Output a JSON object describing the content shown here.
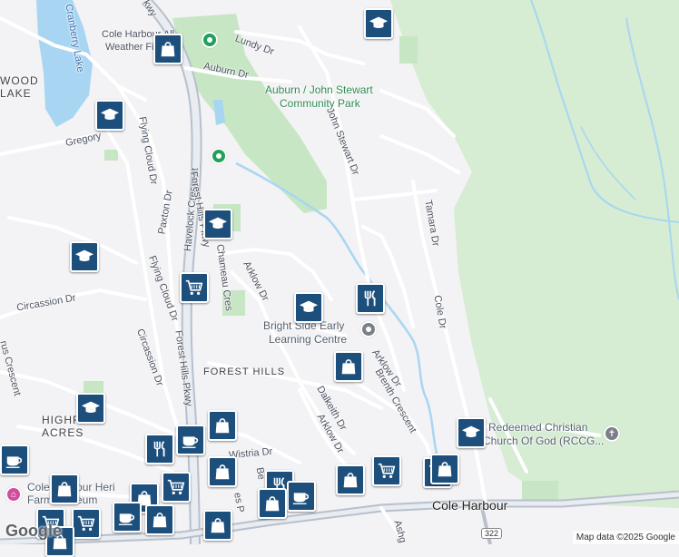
{
  "map": {
    "attribution": "Map data ©2025 Google",
    "logo": "Google",
    "route_shield": "322",
    "colors": {
      "marker": "#1d4f7c",
      "park": "#c7e6c4",
      "woods": "#d6ecd3",
      "water": "#a8d6f2",
      "road": "#ffffff",
      "highway": "#b7c0cc"
    }
  },
  "labels": {
    "cole_harbour_wx_a": "Cole Harbour All",
    "cole_harbour_wx_b": "Weather Field",
    "lundy": "Lundy Dr",
    "auburn": "Auburn Dr",
    "park_a": "Auburn / John Stewart",
    "park_b": "Community Park",
    "john_stewart": "John Stewart Dr",
    "gregory": "Gregory",
    "flying_cloud_top": "Flying Cloud Dr",
    "paxton": "Paxton Dr",
    "havelock": "Havelock Crescent",
    "forest_hills_top": "Forest Hills Pkwy",
    "chameau": "Chameau Cres",
    "arklow_top": "Arklow Dr",
    "tamara": "Tamara Dr",
    "cole_dr": "Cole Dr",
    "bright_a": "Bright Side Early",
    "bright_b": "Learning Centre",
    "arklow_mid": "Arklow Dr",
    "forest_hills_area": "FOREST HILLS",
    "circassion_left": "Circassion Dr",
    "circassion_mid": "Circassion Dr",
    "flying_cloud_mid": "Flying Cloud Dr",
    "forest_hills_mid": "Forest Hills Pkwy",
    "dalkeith": "Dalkeith Dr",
    "arklow_low": "Arklow Dr",
    "brenth": "Brenth Crescent",
    "highfield_a": "HIGHF",
    "highfield_b": "ACRES",
    "wood_lake_a": "WOOD",
    "wood_lake_b": "LAKE",
    "cranberry": "Cranberry Lake",
    "redeemed_a": "Redeemed Christian",
    "redeemed_b": "Church Of God (RCCG...",
    "wistria": "Wistria Dr",
    "cole_harbour_town": "Cole Harbour",
    "farm_a": "Cole Harbour Heri",
    "farm_b": "Farm Museum",
    "crescent_left": "rus Crescent",
    "ashgrove": "Ashg",
    "be_label": "Be",
    "es_label": "es P",
    "top_parkway": "Pkwy"
  },
  "markers": [
    {
      "name": "school-icon",
      "kind": "school"
    },
    {
      "name": "shopping-bag-icon",
      "kind": "bag"
    },
    {
      "name": "school-icon",
      "kind": "school"
    },
    {
      "name": "school-icon",
      "kind": "school"
    },
    {
      "name": "school-icon",
      "kind": "school"
    },
    {
      "name": "cart-icon",
      "kind": "cart"
    },
    {
      "name": "school-icon",
      "kind": "school"
    },
    {
      "name": "restaurant-icon",
      "kind": "food"
    },
    {
      "name": "shopping-bag-icon",
      "kind": "bag"
    },
    {
      "name": "school-icon",
      "kind": "school"
    },
    {
      "name": "shopping-bag-icon",
      "kind": "bag"
    },
    {
      "name": "school-icon",
      "kind": "school"
    },
    {
      "name": "coffee-icon",
      "kind": "cafe"
    },
    {
      "name": "restaurant-icon",
      "kind": "food"
    },
    {
      "name": "coffee-icon",
      "kind": "cafe"
    },
    {
      "name": "shopping-bag-icon",
      "kind": "bag"
    },
    {
      "name": "cart-icon",
      "kind": "cart"
    },
    {
      "name": "shopping-bag-icon",
      "kind": "bag"
    },
    {
      "name": "shopping-bag-icon",
      "kind": "bag"
    },
    {
      "name": "cart-icon",
      "kind": "cart"
    },
    {
      "name": "shopping-bag-icon",
      "kind": "bag"
    },
    {
      "name": "restaurant-icon",
      "kind": "food"
    },
    {
      "name": "coffee-icon",
      "kind": "cafe"
    },
    {
      "name": "shopping-bag-icon",
      "kind": "bag"
    },
    {
      "name": "shopping-bag-icon",
      "kind": "bag"
    },
    {
      "name": "cart-icon",
      "kind": "cart"
    },
    {
      "name": "coffee-icon",
      "kind": "cafe"
    },
    {
      "name": "shopping-bag-icon",
      "kind": "bag"
    },
    {
      "name": "cart-icon",
      "kind": "cart"
    },
    {
      "name": "cart-icon",
      "kind": "cart"
    },
    {
      "name": "shopping-bag-icon",
      "kind": "bag"
    },
    {
      "name": "shopping-bag-icon",
      "kind": "bag"
    }
  ]
}
